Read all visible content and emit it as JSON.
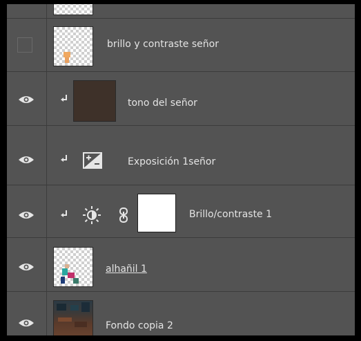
{
  "layers": [
    {
      "label": "brillo y contraste señor",
      "visible": false,
      "clipped": false,
      "thumbnail": "transparent-with-figure",
      "linked": false,
      "mask": false
    },
    {
      "label": "tono del señor",
      "visible": true,
      "clipped": true,
      "thumbnail": "solid-dark-brown",
      "linked": false,
      "mask": false
    },
    {
      "label": "Exposición 1señor",
      "visible": true,
      "clipped": true,
      "thumbnail": "exposure-icon",
      "linked": false,
      "mask": false
    },
    {
      "label": "Brillo/contraste 1",
      "visible": true,
      "clipped": true,
      "thumbnail": "brightness-icon",
      "linked": true,
      "mask": true
    },
    {
      "label": "alhañil 1",
      "visible": true,
      "clipped": false,
      "thumbnail": "transparent-with-figure",
      "linked": false,
      "mask": false
    },
    {
      "label": "Fondo copia 2",
      "visible": true,
      "clipped": false,
      "thumbnail": "photo",
      "linked": false,
      "mask": false
    }
  ],
  "colors": {
    "panel_bg": "#535353",
    "divider": "#3b3b3b",
    "text": "#e4e4e4",
    "fill_swatch": "#3e3129",
    "figure_accent": "#f0a860"
  }
}
